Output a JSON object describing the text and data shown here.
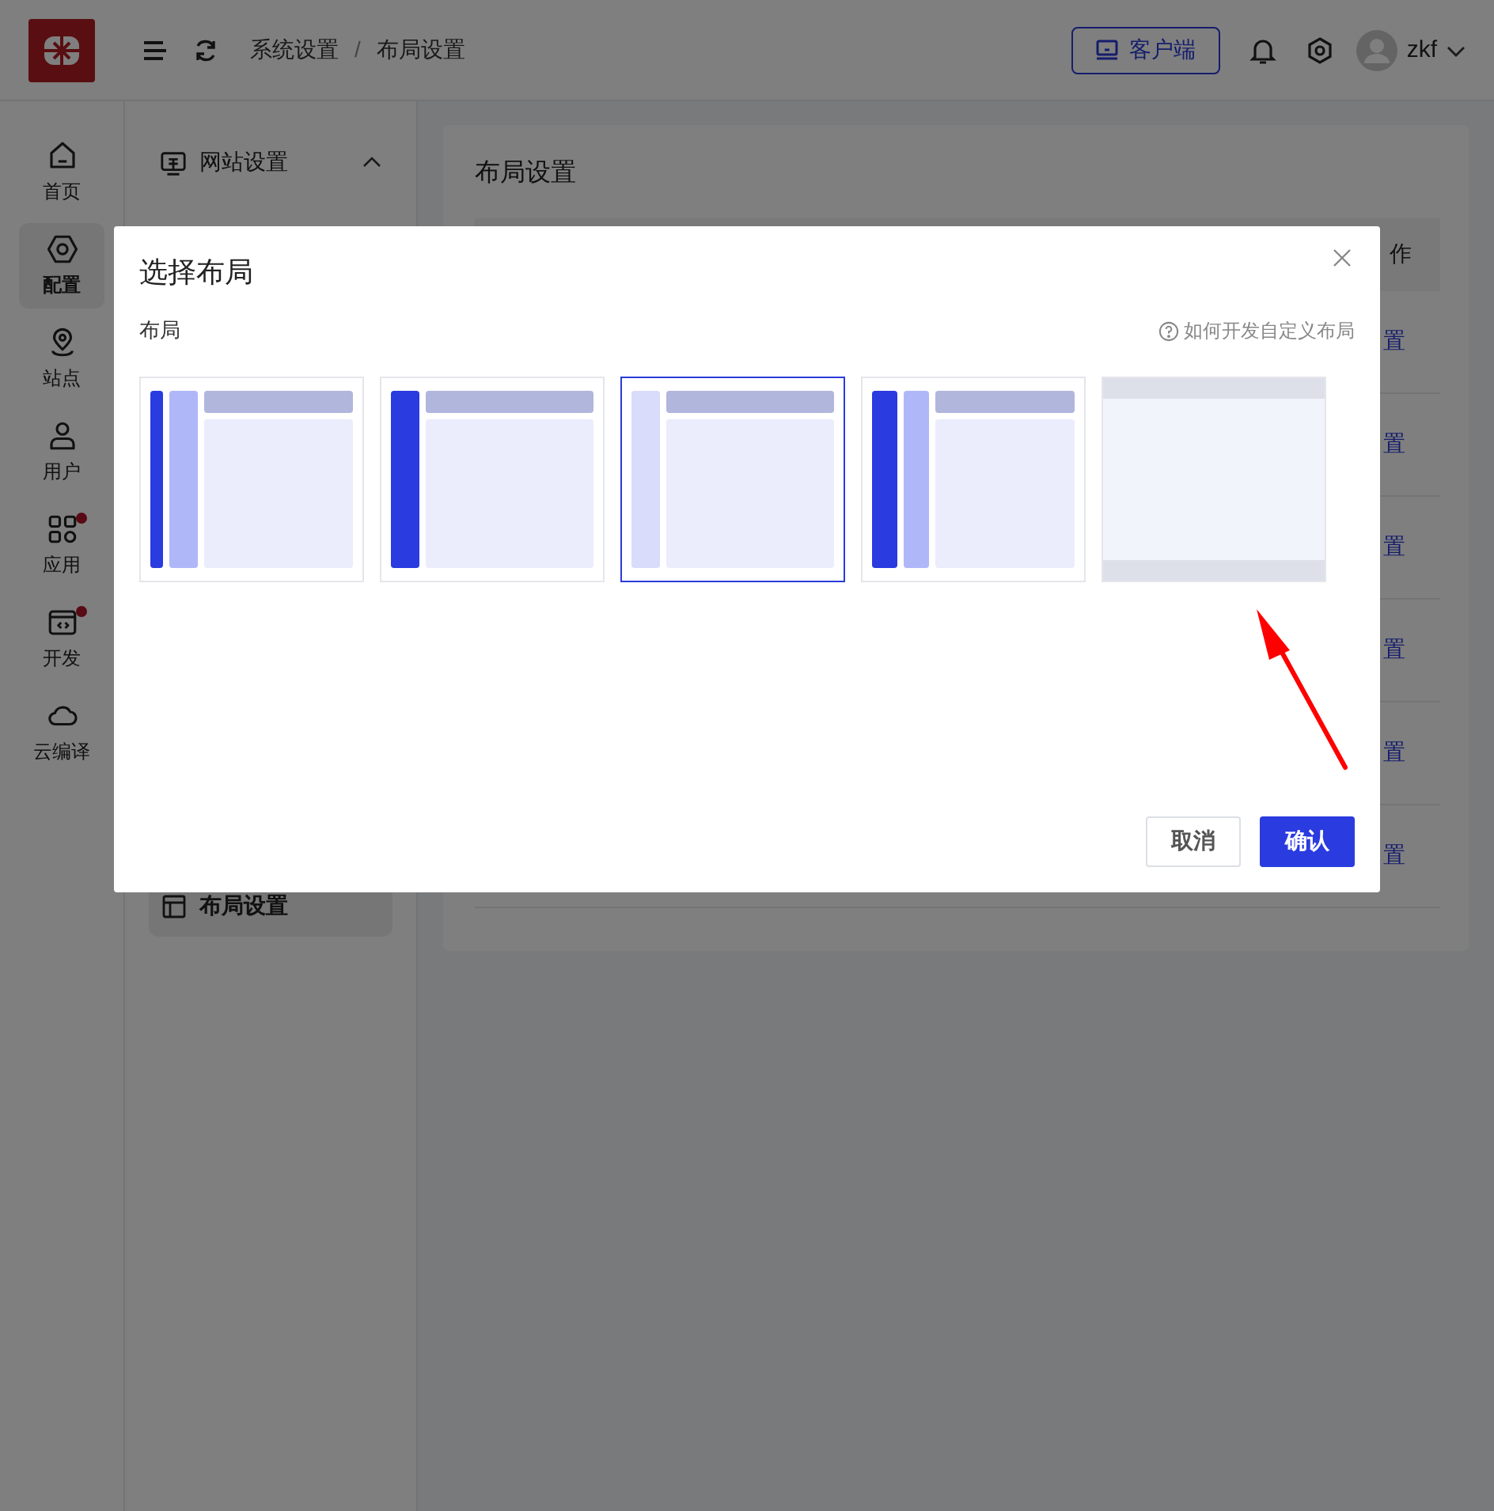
{
  "header": {
    "breadcrumb": [
      "系统设置",
      "布局设置"
    ],
    "breadcrumb_separator": "/",
    "client_button": "客户端",
    "user": "zkf"
  },
  "rail": [
    {
      "label": "首页",
      "selected": false,
      "dot": false
    },
    {
      "label": "配置",
      "selected": true,
      "dot": false
    },
    {
      "label": "站点",
      "selected": false,
      "dot": false
    },
    {
      "label": "用户",
      "selected": false,
      "dot": false
    },
    {
      "label": "应用",
      "selected": false,
      "dot": true
    },
    {
      "label": "开发",
      "selected": false,
      "dot": true
    },
    {
      "label": "云编译",
      "selected": false,
      "dot": false
    }
  ],
  "sidebar": {
    "group": "网站设置",
    "expanded": true,
    "items": [
      {
        "label": "布局设置",
        "selected": true
      }
    ]
  },
  "content": {
    "title": "布局设置",
    "action_header": "作",
    "rows": [
      "置",
      "置",
      "置",
      "置",
      "置",
      "置"
    ]
  },
  "modal": {
    "title": "选择布局",
    "field_label": "布局",
    "help_link": "如何开发自定义布局",
    "layouts": [
      {
        "kind": "dual",
        "selected": false
      },
      {
        "kind": "single",
        "selected": false
      },
      {
        "kind": "light",
        "selected": true
      },
      {
        "kind": "dualwide",
        "selected": false
      },
      {
        "kind": "topbottom",
        "selected": false
      }
    ],
    "cancel": "取消",
    "confirm": "确认"
  }
}
